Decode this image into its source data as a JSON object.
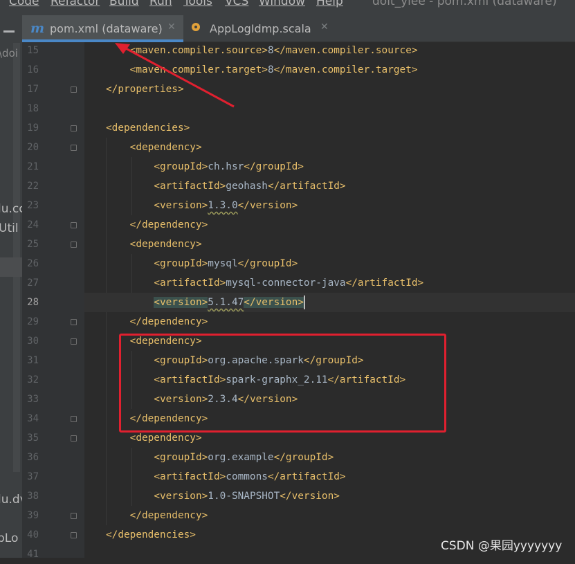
{
  "menubar": {
    "items": [
      "Code",
      "Refactor",
      "Build",
      "Run",
      "Tools",
      "VCS",
      "Window",
      "Help"
    ],
    "window_title": "doit_ylee - pom.xml (dataware)"
  },
  "project_panel": {
    "fragments": [
      "\\doi",
      "lu.cc",
      "Util",
      "lu.dv",
      "pLo"
    ]
  },
  "tabs": [
    {
      "label": "pom.xml (dataware)",
      "icon": "maven-m-icon",
      "active": true
    },
    {
      "label": "AppLogIdmp.scala",
      "icon": "scala-object-icon",
      "active": false
    }
  ],
  "editor": {
    "current_line": 28,
    "lines": [
      {
        "num": 15,
        "fold": false,
        "segs": [
          [
            "    ",
            "txt"
          ],
          [
            "<maven.compiler.source>",
            "tag"
          ],
          [
            "8",
            "txt"
          ],
          [
            "</maven.compiler.source>",
            "tag"
          ]
        ]
      },
      {
        "num": 16,
        "fold": false,
        "segs": [
          [
            "    ",
            "txt"
          ],
          [
            "<maven.compiler.target>",
            "tag"
          ],
          [
            "8",
            "txt"
          ],
          [
            "</maven.compiler.target>",
            "tag"
          ]
        ]
      },
      {
        "num": 17,
        "fold": true,
        "segs": [
          [
            "</properties>",
            "tag"
          ]
        ]
      },
      {
        "num": 18,
        "fold": false,
        "segs": []
      },
      {
        "num": 19,
        "fold": true,
        "segs": [
          [
            "<dependencies>",
            "tag"
          ]
        ]
      },
      {
        "num": 20,
        "fold": true,
        "segs": [
          [
            "    ",
            "txt"
          ],
          [
            "<dependency>",
            "tag"
          ]
        ]
      },
      {
        "num": 21,
        "fold": false,
        "segs": [
          [
            "        ",
            "txt"
          ],
          [
            "<groupId>",
            "tag"
          ],
          [
            "ch.hsr",
            "txt"
          ],
          [
            "</groupId>",
            "tag"
          ]
        ]
      },
      {
        "num": 22,
        "fold": false,
        "segs": [
          [
            "        ",
            "txt"
          ],
          [
            "<artifactId>",
            "tag"
          ],
          [
            "geohash",
            "txt"
          ],
          [
            "</artifactId>",
            "tag"
          ]
        ]
      },
      {
        "num": 23,
        "fold": false,
        "segs": [
          [
            "        ",
            "txt"
          ],
          [
            "<version>",
            "tag"
          ],
          [
            "1.3.0",
            "warn"
          ],
          [
            "</version>",
            "tag"
          ]
        ]
      },
      {
        "num": 24,
        "fold": true,
        "segs": [
          [
            "    ",
            "txt"
          ],
          [
            "</dependency>",
            "tag"
          ]
        ]
      },
      {
        "num": 25,
        "fold": true,
        "segs": [
          [
            "    ",
            "txt"
          ],
          [
            "<dependency>",
            "tag"
          ]
        ]
      },
      {
        "num": 26,
        "fold": false,
        "segs": [
          [
            "        ",
            "txt"
          ],
          [
            "<groupId>",
            "tag"
          ],
          [
            "mysql",
            "txt"
          ],
          [
            "</groupId>",
            "tag"
          ]
        ]
      },
      {
        "num": 27,
        "fold": false,
        "segs": [
          [
            "        ",
            "txt"
          ],
          [
            "<artifactId>",
            "tag"
          ],
          [
            "mysql-connector-java",
            "txt"
          ],
          [
            "</artifactId>",
            "tag"
          ]
        ]
      },
      {
        "num": 28,
        "fold": false,
        "segs": [
          [
            "        ",
            "txt"
          ],
          [
            "<version>",
            "taghl"
          ],
          [
            "5.1.47",
            "warn"
          ],
          [
            "</version>",
            "taghl"
          ],
          [
            "",
            "caret"
          ]
        ]
      },
      {
        "num": 29,
        "fold": true,
        "segs": [
          [
            "    ",
            "txt"
          ],
          [
            "</dependency>",
            "tag"
          ]
        ]
      },
      {
        "num": 30,
        "fold": true,
        "segs": [
          [
            "    ",
            "txt"
          ],
          [
            "<dependency>",
            "tag"
          ]
        ]
      },
      {
        "num": 31,
        "fold": false,
        "segs": [
          [
            "        ",
            "txt"
          ],
          [
            "<groupId>",
            "tag"
          ],
          [
            "org.apache.spark",
            "txt"
          ],
          [
            "</groupId>",
            "tag"
          ]
        ]
      },
      {
        "num": 32,
        "fold": false,
        "segs": [
          [
            "        ",
            "txt"
          ],
          [
            "<artifactId>",
            "tag"
          ],
          [
            "spark-graphx_2.11",
            "txt"
          ],
          [
            "</artifactId>",
            "tag"
          ]
        ]
      },
      {
        "num": 33,
        "fold": false,
        "segs": [
          [
            "        ",
            "txt"
          ],
          [
            "<version>",
            "tag"
          ],
          [
            "2.3.4",
            "txt"
          ],
          [
            "</version>",
            "tag"
          ]
        ]
      },
      {
        "num": 34,
        "fold": true,
        "segs": [
          [
            "    ",
            "txt"
          ],
          [
            "</dependency>",
            "tag"
          ]
        ]
      },
      {
        "num": 35,
        "fold": true,
        "segs": [
          [
            "    ",
            "txt"
          ],
          [
            "<dependency>",
            "tag"
          ]
        ]
      },
      {
        "num": 36,
        "fold": false,
        "segs": [
          [
            "        ",
            "txt"
          ],
          [
            "<groupId>",
            "tag"
          ],
          [
            "org.example",
            "txt"
          ],
          [
            "</groupId>",
            "tag"
          ]
        ]
      },
      {
        "num": 37,
        "fold": false,
        "segs": [
          [
            "        ",
            "txt"
          ],
          [
            "<artifactId>",
            "tag"
          ],
          [
            "commons",
            "txt"
          ],
          [
            "</artifactId>",
            "tag"
          ]
        ]
      },
      {
        "num": 38,
        "fold": false,
        "segs": [
          [
            "        ",
            "txt"
          ],
          [
            "<version>",
            "tag"
          ],
          [
            "1.0-SNAPSHOT",
            "txt"
          ],
          [
            "</version>",
            "tag"
          ]
        ]
      },
      {
        "num": 39,
        "fold": true,
        "segs": [
          [
            "    ",
            "txt"
          ],
          [
            "</dependency>",
            "tag"
          ]
        ]
      },
      {
        "num": 40,
        "fold": true,
        "segs": [
          [
            "</dependencies>",
            "tag"
          ]
        ]
      },
      {
        "num": 41,
        "fold": false,
        "segs": []
      }
    ]
  },
  "annotations": {
    "highlight_color": "#e0202f"
  },
  "watermark": "CSDN @果园yyyyyyy",
  "colors": {
    "tag": "#e8bf6a",
    "text": "#a9b7c6",
    "background": "#2b2b2b",
    "gutter": "#313335",
    "tab_underline": "#4a88c7"
  }
}
